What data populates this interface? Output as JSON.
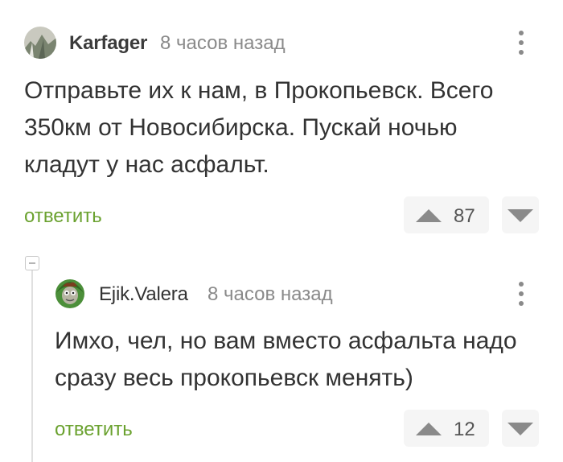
{
  "comments": [
    {
      "author": "Karfager",
      "time": "8 часов назад",
      "text_lines": [
        "Отправьте их к нам, в Прокопьевск. Всего",
        "350км от Новосибирска. Пускай ночью",
        "кладут у нас асфальт."
      ],
      "reply_label": "ответить",
      "score": "87"
    },
    {
      "author": "Ejik.Valera",
      "time": "8 часов назад",
      "text_lines": [
        "Имхо, чел, но вам вместо асфальта надо",
        "сразу весь прокопьевск менять)"
      ],
      "reply_label": "ответить",
      "score": "12"
    }
  ],
  "colors": {
    "reply": "#6ba230",
    "vote_bg": "#f5f5f5",
    "icon": "#8a8a8a"
  },
  "icons": [
    "avatar",
    "more-vertical-icon",
    "upvote-icon",
    "downvote-icon",
    "collapse-thread-icon"
  ]
}
